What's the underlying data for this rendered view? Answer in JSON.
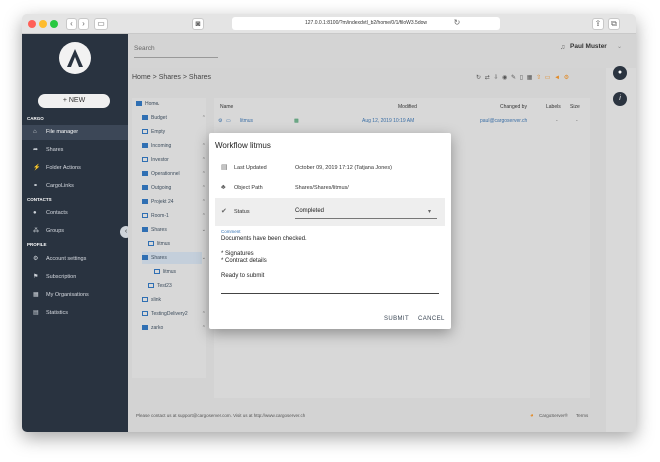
{
  "browser": {
    "url": "127.0.0.1:8100/?m/indexdvtl_b2/home/0/1/filoW3.5dow",
    "colors": {
      "close": "#ff5f57",
      "minimize": "#febc2e",
      "zoom": "#28c840"
    }
  },
  "sidebar": {
    "new_label": "+ NEW",
    "sections": [
      {
        "label": "CARGO",
        "items": [
          {
            "label": "File manager",
            "icon": "file-manager-icon"
          },
          {
            "label": "Shares",
            "icon": "share-icon"
          },
          {
            "label": "Folder Actions",
            "icon": "folder-actions-icon"
          },
          {
            "label": "CargoLinks",
            "icon": "link-icon"
          }
        ]
      },
      {
        "label": "CONTACTS",
        "items": [
          {
            "label": "Contacts",
            "icon": "contact-icon"
          },
          {
            "label": "Groups",
            "icon": "groups-icon"
          }
        ]
      },
      {
        "label": "PROFILE",
        "items": [
          {
            "label": "Account settings",
            "icon": "gear-icon"
          },
          {
            "label": "Subscription",
            "icon": "flag-icon"
          },
          {
            "label": "My Organisations",
            "icon": "building-icon"
          },
          {
            "label": "Statistics",
            "icon": "chart-icon"
          }
        ]
      }
    ]
  },
  "topbar": {
    "search_placeholder": "Search",
    "user_name": "Paul Muster"
  },
  "breadcrumb": {
    "home": "Home",
    "shares1": "Shares",
    "shares2": "Shares",
    "sep": ">"
  },
  "tree": [
    {
      "label": "Home"
    },
    {
      "label": "Budget"
    },
    {
      "label": "Empty"
    },
    {
      "label": "Incoming"
    },
    {
      "label": "Investor"
    },
    {
      "label": "Operationnel"
    },
    {
      "label": "Outgoing"
    },
    {
      "label": "Projekt 24"
    },
    {
      "label": "Room-1"
    },
    {
      "label": "Shares"
    },
    {
      "label": "litmus"
    },
    {
      "label": "Shares"
    },
    {
      "label": "litmus"
    },
    {
      "label": "Test23"
    },
    {
      "label": "slink"
    },
    {
      "label": "TestingDelivery2"
    },
    {
      "label": "zarko"
    }
  ],
  "grid": {
    "headers": {
      "name": "Name",
      "modified": "Modified",
      "changed_by": "Changed by",
      "labels": "Labels",
      "size": "Size"
    },
    "row": {
      "name": "litmus",
      "modified": "Aug 12, 2019 10:19 AM",
      "changed_by": "paul@cargoserver.ch",
      "labels": "-",
      "size": "-"
    }
  },
  "footer": {
    "contact": "Please contact us at support@cargoserver.com. Visit us at http://www.cargoserver.ch",
    "brand": "CargoServer®",
    "terms": "Terms"
  },
  "dialog": {
    "title": "Workflow  litmus",
    "last_updated_label": "Last Updated",
    "last_updated_value": "October 09, 2019 17:12 (Tatjana Jones)",
    "object_path_label": "Object Path",
    "object_path_value": "Shares/Shares/litmus/",
    "status_label": "Status",
    "status_value": "Completed",
    "comment_label": "Comment",
    "comment_line1": "Documents have been checked.",
    "comment_line2": "* Signatures",
    "comment_line3": "* Contract details",
    "comment_line4": "Ready to submit",
    "submit_label": "SUBMIT",
    "cancel_label": "CANCEL"
  }
}
